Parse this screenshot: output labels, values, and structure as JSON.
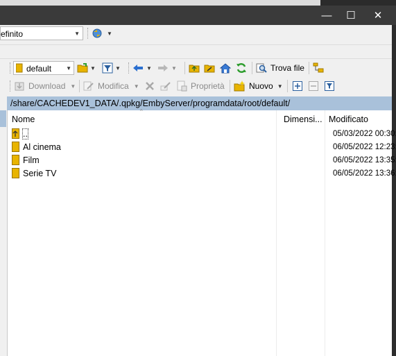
{
  "window": {
    "minimize_glyph": "—",
    "maximize_glyph": "☐",
    "close_glyph": "✕"
  },
  "top_combo": {
    "value": "efinito"
  },
  "toolbar1": {
    "bookmark_combo": "default",
    "find_files_label": "Trova file"
  },
  "toolbar2": {
    "download_label": "Download",
    "edit_label": "Modifica",
    "properties_label": "Proprietà",
    "new_label": "Nuovo"
  },
  "path": "/share/CACHEDEV1_DATA/.qpkg/EmbyServer/programdata/root/default/",
  "columns": {
    "name": "Nome",
    "size": "Dimensi...",
    "modified": "Modificato"
  },
  "rows": [
    {
      "name": "..",
      "modified": "05/03/2022 00:30:"
    },
    {
      "name": "Al cinema",
      "modified": "06/05/2022 12:23:"
    },
    {
      "name": "Film",
      "modified": "06/05/2022 13:35:"
    },
    {
      "name": "Serie TV",
      "modified": "06/05/2022 13:36:"
    }
  ],
  "colors": {
    "path_bar": "#a9c1da",
    "folder": "#e8b400",
    "titlebar": "#3a3a3a"
  }
}
